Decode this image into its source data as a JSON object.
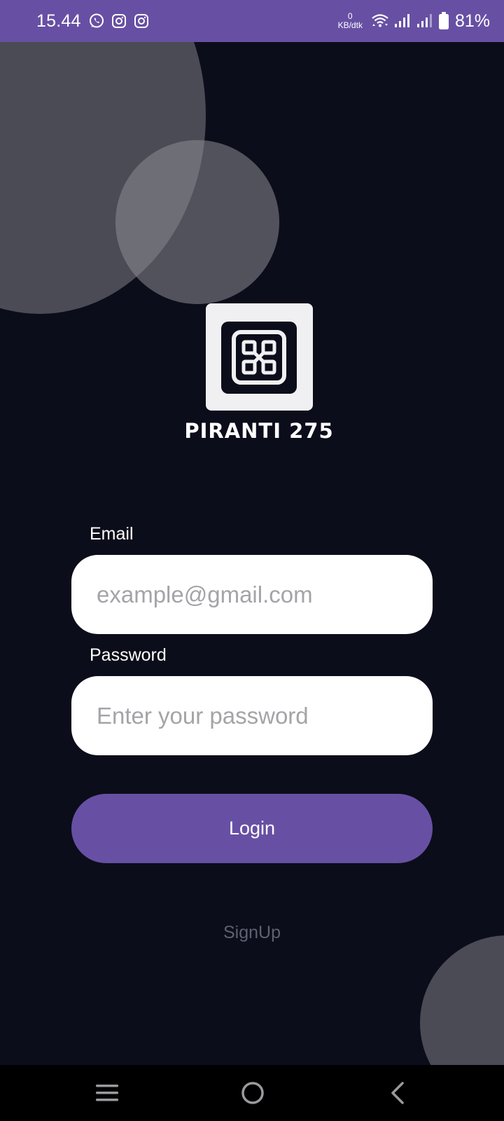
{
  "status_bar": {
    "time": "15.44",
    "app_icons": [
      "whatsapp-icon",
      "instagram-icon",
      "instagram-icon"
    ],
    "net_speed_value": "0",
    "net_speed_unit": "KB/dtk",
    "battery": "81%",
    "color": "#6750a4"
  },
  "logo": {
    "text": "PIRANTI 275"
  },
  "form": {
    "email_label": "Email",
    "email_placeholder": "example@gmail.com",
    "email_value": "",
    "password_label": "Password",
    "password_placeholder": "Enter your password",
    "password_value": "",
    "login_label": "Login",
    "signup_label": "SignUp"
  },
  "colors": {
    "accent": "#6750a4",
    "background": "#0c0d1a",
    "muted_link": "#5f6070"
  },
  "nav_bar": {
    "icons": [
      "menu-icon",
      "home-icon",
      "back-icon"
    ]
  }
}
